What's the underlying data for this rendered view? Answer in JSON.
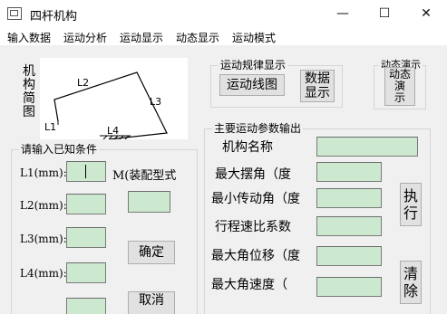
{
  "window": {
    "title": "四杆机构",
    "minimize_glyph": "—",
    "maximize_glyph": "☐",
    "close_glyph": "✕"
  },
  "menu": [
    "输入数据",
    "运动分析",
    "运动显示",
    "动态显示",
    "运动模式"
  ],
  "diagram": {
    "caption_chars": [
      "机",
      "构",
      "简",
      "图"
    ],
    "link_labels": {
      "l1": "L1",
      "l2": "L2",
      "l3": "L3",
      "l4": "L4"
    }
  },
  "motion_law_group": {
    "title": "运动规律显示",
    "line_button": "运动线图",
    "data_button": [
      "数据",
      "显示"
    ]
  },
  "animation_group": {
    "title": "动态演示",
    "button": [
      "动态",
      "演",
      "示"
    ]
  },
  "known_conditions": {
    "title": "请输入已知条件",
    "fields": [
      {
        "label": "L1(mm):",
        "value": ""
      },
      {
        "label": "L2(mm):",
        "value": ""
      },
      {
        "label": "L3(mm):",
        "value": ""
      },
      {
        "label": "L4(mm):",
        "value": ""
      }
    ],
    "assembly_label": "M(装配型式",
    "assembly_value": "",
    "confirm_button": "确定",
    "cancel_button": "取消"
  },
  "output_group": {
    "title": "主要运动参数输出",
    "rows": [
      {
        "label": "机构名称",
        "value": ""
      },
      {
        "label": "最大摆角（度",
        "value": ""
      },
      {
        "label": "最小传动角（度",
        "value": ""
      },
      {
        "label": "行程速比系数",
        "value": ""
      },
      {
        "label": "最大角位移（度",
        "value": ""
      },
      {
        "label": "最大角速度（",
        "value": ""
      }
    ],
    "execute_button": [
      "执",
      "行"
    ],
    "clear_button": [
      "清",
      "除"
    ]
  }
}
